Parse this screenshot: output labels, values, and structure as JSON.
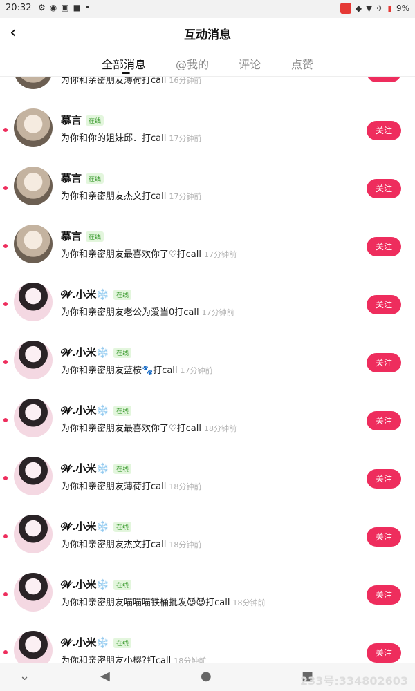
{
  "status_bar": {
    "time": "20:32",
    "icons": [
      "settings-icon",
      "app-icon",
      "app-icon",
      "square-icon",
      "dot-icon"
    ],
    "battery": "9%"
  },
  "header": {
    "title": "互动消息",
    "back_icon": "back-arrow-icon"
  },
  "tabs": [
    {
      "label": "全部消息",
      "active": true
    },
    {
      "label": "@我的"
    },
    {
      "label": "评论"
    },
    {
      "label": "点赞"
    }
  ],
  "follow_label": "关注",
  "online_label": "在线",
  "items": [
    {
      "name": "",
      "message": "为你和亲密朋友薄荷打call",
      "time": "16分钟前",
      "avatar": "a1",
      "partial_top": true
    },
    {
      "name": "慕言",
      "message": "为你和你的姐妹邱．打call",
      "time": "17分钟前",
      "avatar": "a1"
    },
    {
      "name": "慕言",
      "message": "为你和亲密朋友杰文打call",
      "time": "17分钟前",
      "avatar": "a1"
    },
    {
      "name": "慕言",
      "message": "为你和亲密朋友最喜欢你了♡打call",
      "time": "17分钟前",
      "avatar": "a1"
    },
    {
      "name": "𝓦.小米❄️",
      "message": "为你和亲密朋友老公为爱当0打call",
      "time": "17分钟前",
      "avatar": "a2"
    },
    {
      "name": "𝓦.小米❄️",
      "message": "为你和亲密朋友蓝桉🐾打call",
      "time": "17分钟前",
      "avatar": "a2"
    },
    {
      "name": "𝓦.小米❄️",
      "message": "为你和亲密朋友最喜欢你了♡打call",
      "time": "18分钟前",
      "avatar": "a2"
    },
    {
      "name": "𝓦.小米❄️",
      "message": "为你和亲密朋友薄荷打call",
      "time": "18分钟前",
      "avatar": "a2"
    },
    {
      "name": "𝓦.小米❄️",
      "message": "为你和亲密朋友杰文打call",
      "time": "18分钟前",
      "avatar": "a2"
    },
    {
      "name": "𝓦.小米❄️",
      "message": "为你和亲密朋友喵喵喵铁桶批发😈😈打call",
      "time": "18分钟前",
      "avatar": "a2"
    },
    {
      "name": "𝓦.小米❄️",
      "message": "为你和亲密朋友小樱?打call",
      "time": "18分钟前",
      "avatar": "a2"
    }
  ],
  "nav": {
    "down_icon": "chevron-down-icon",
    "back_icon": "triangle-back-icon",
    "home_icon": "circle-home-icon",
    "recent_icon": "square-recent-icon"
  },
  "watermark": "233号:334802603"
}
